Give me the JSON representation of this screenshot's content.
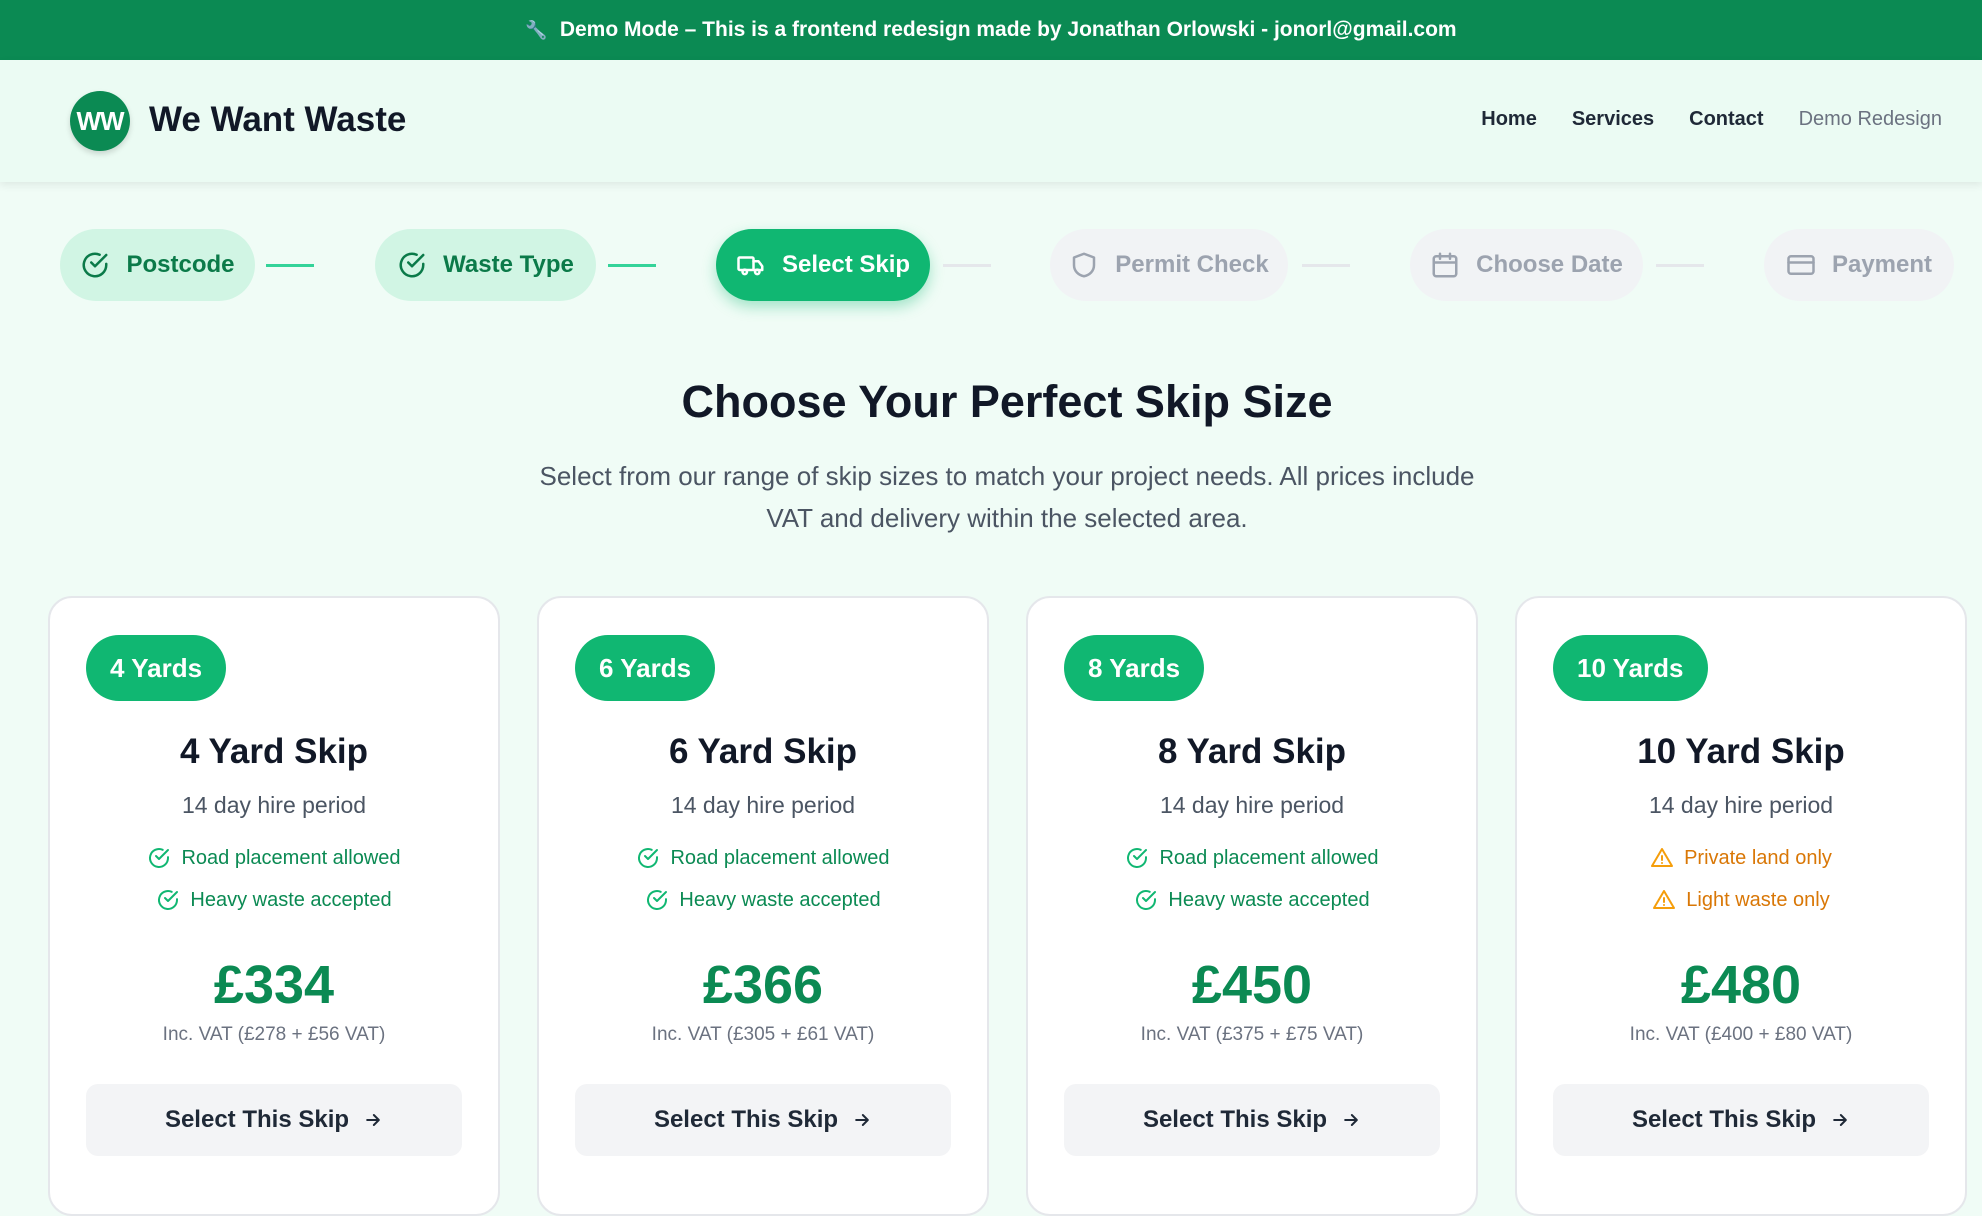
{
  "banner": {
    "icon": "wrench-icon",
    "text": "Demo Mode – This is a frontend redesign made by Jonathan Orlowski - jonorl@gmail.com"
  },
  "header": {
    "logo_initials": "WW",
    "brand": "We Want Waste",
    "nav": [
      "Home",
      "Services",
      "Contact",
      "Demo Redesign"
    ]
  },
  "steps": [
    {
      "label": "Postcode",
      "state": "done",
      "icon": "check-circle-icon"
    },
    {
      "label": "Waste Type",
      "state": "done",
      "icon": "check-circle-icon"
    },
    {
      "label": "Select Skip",
      "state": "active",
      "icon": "truck-icon"
    },
    {
      "label": "Permit Check",
      "state": "todo",
      "icon": "shield-icon"
    },
    {
      "label": "Choose Date",
      "state": "todo",
      "icon": "calendar-icon"
    },
    {
      "label": "Payment",
      "state": "todo",
      "icon": "credit-card-icon"
    }
  ],
  "main": {
    "title": "Choose Your Perfect Skip Size",
    "subtitle_line1": "Select from our range of skip sizes to match your project needs. All prices include",
    "subtitle_line2": "VAT and delivery within the selected area."
  },
  "cards": [
    {
      "badge": "4 Yards",
      "title": "4 Yard Skip",
      "hire": "14 day hire period",
      "features": [
        {
          "text": "Road placement allowed",
          "type": "ok"
        },
        {
          "text": "Heavy waste accepted",
          "type": "ok"
        }
      ],
      "price": "£334",
      "vat": "Inc. VAT (£278 + £56 VAT)",
      "button": "Select This Skip"
    },
    {
      "badge": "6 Yards",
      "title": "6 Yard Skip",
      "hire": "14 day hire period",
      "features": [
        {
          "text": "Road placement allowed",
          "type": "ok"
        },
        {
          "text": "Heavy waste accepted",
          "type": "ok"
        }
      ],
      "price": "£366",
      "vat": "Inc. VAT (£305 + £61 VAT)",
      "button": "Select This Skip"
    },
    {
      "badge": "8 Yards",
      "title": "8 Yard Skip",
      "hire": "14 day hire period",
      "features": [
        {
          "text": "Road placement allowed",
          "type": "ok"
        },
        {
          "text": "Heavy waste accepted",
          "type": "ok"
        }
      ],
      "price": "£450",
      "vat": "Inc. VAT (£375 + £75 VAT)",
      "button": "Select This Skip"
    },
    {
      "badge": "10 Yards",
      "title": "10 Yard Skip",
      "hire": "14 day hire period",
      "features": [
        {
          "text": "Private land only",
          "type": "warn"
        },
        {
          "text": "Light waste only",
          "type": "warn"
        }
      ],
      "price": "£480",
      "vat": "Inc. VAT (£400 + £80 VAT)",
      "button": "Select This Skip"
    }
  ],
  "colors": {
    "brand": "#0b8a53",
    "accent": "#10b772",
    "warn": "#d97706"
  }
}
